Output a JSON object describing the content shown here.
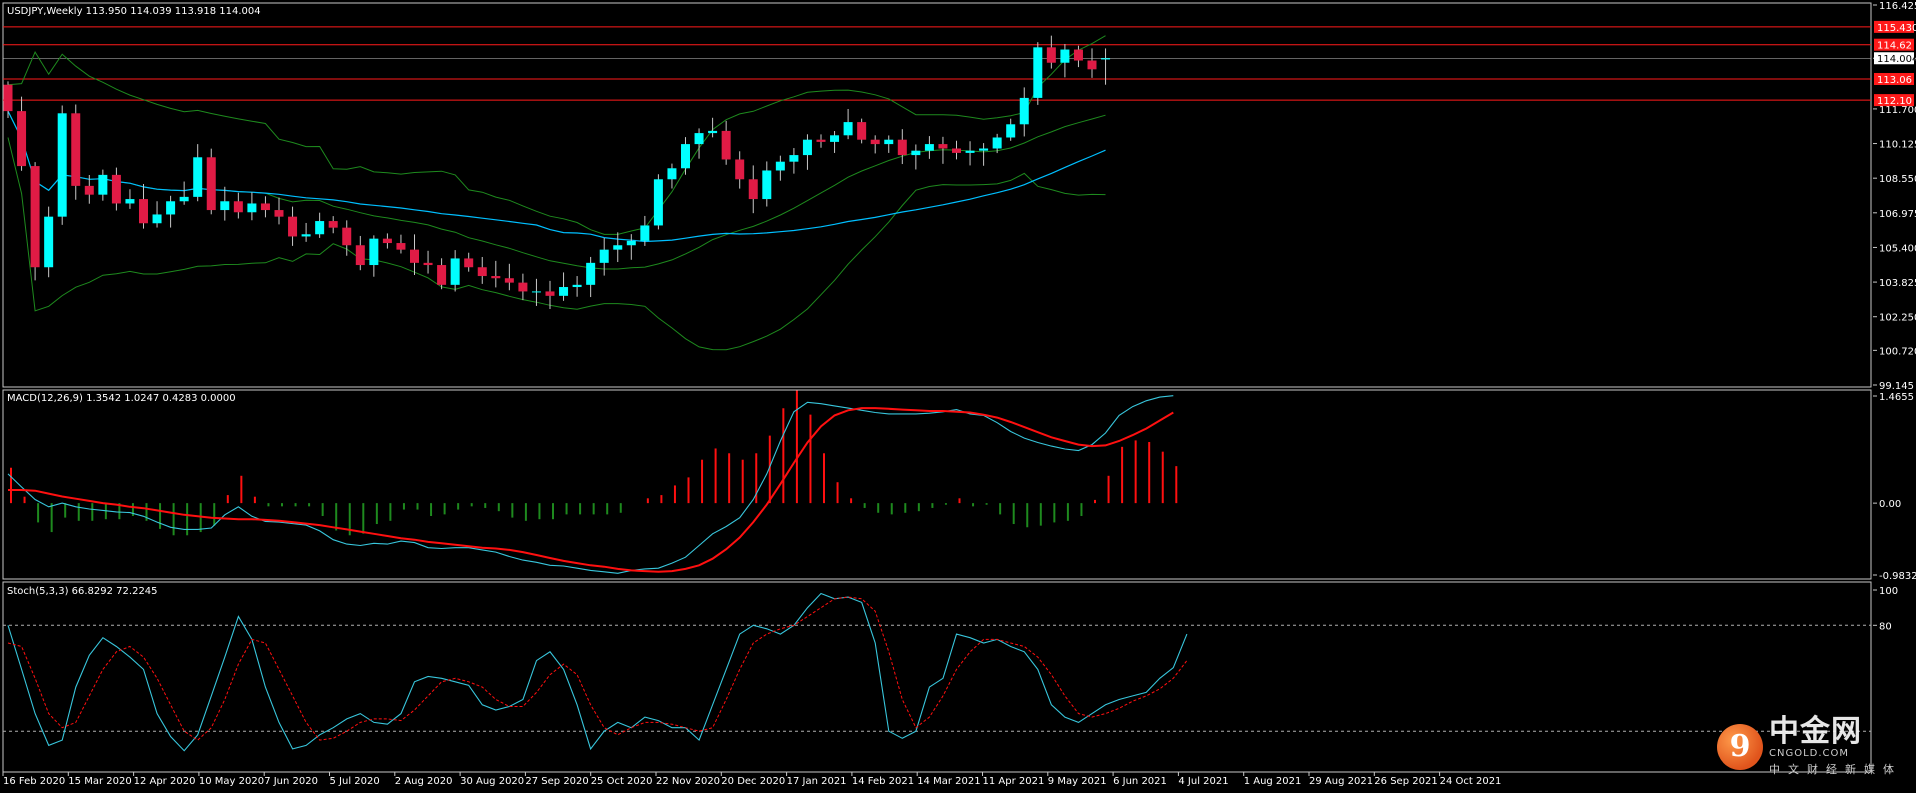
{
  "symbol_header": "USDJPY,Weekly  113.950 114.039 113.918 114.004",
  "macd_header": "MACD(12,26,9) 1.3542 1.0247 0.4283 0.0000",
  "stoch_header": "Stoch(5,3,3) 66.8292 72.2245",
  "colors": {
    "background": "#000000",
    "bull_candle": "#00ffff",
    "bear_candle": "#e01b45",
    "bollinger": "#1e8a1e",
    "ma": "#00bfff",
    "macd_line": "#38c6dc",
    "signal_line": "#ff1010",
    "hist_pos": "#ff1010",
    "hist_neg": "#1e8a1e",
    "hline": "#ff1a1a"
  },
  "logo": {
    "mark": "9",
    "name": "中金网",
    "site": "CNGOLD.COM",
    "tagline": "中文财经新媒体"
  },
  "chart_data": [
    {
      "type": "candlestick",
      "title": "USDJPY,Weekly",
      "ohlc_current": {
        "open": 113.95,
        "high": 114.039,
        "low": 113.918,
        "close": 114.004
      },
      "ylim": [
        99.145,
        116.425
      ],
      "y_ticks": [
        "116.425",
        "114.004",
        "111.700",
        "110.125",
        "108.550",
        "106.975",
        "105.400",
        "103.825",
        "102.250",
        "100.720",
        "99.145"
      ],
      "x_ticks": [
        "16 Feb 2020",
        "15 Mar 2020",
        "12 Apr 2020",
        "10 May 2020",
        "7 Jun 2020",
        "5 Jul 2020",
        "2 Aug 2020",
        "30 Aug 2020",
        "27 Sep 2020",
        "25 Oct 2020",
        "22 Nov 2020",
        "20 Dec 2020",
        "17 Jan 2021",
        "14 Feb 2021",
        "14 Mar 2021",
        "11 Apr 2021",
        "9 May 2021",
        "6 Jun 2021",
        "4 Jul 2021",
        "1 Aug 2021",
        "29 Aug 2021",
        "26 Sep 2021",
        "24 Oct 2021"
      ],
      "horizontal_levels": [
        {
          "value": 115.43,
          "label": "115.430"
        },
        {
          "value": 114.62,
          "label": "114.62"
        },
        {
          "value": 113.06,
          "label": "113.06"
        },
        {
          "value": 112.1,
          "label": "112.10"
        }
      ],
      "price_badge": {
        "value": 114.004,
        "label": "114.004"
      },
      "closes": [
        111.6,
        109.1,
        104.5,
        106.8,
        111.5,
        108.2,
        107.8,
        108.7,
        107.4,
        107.6,
        106.5,
        106.9,
        107.5,
        107.7,
        109.5,
        107.1,
        107.5,
        107.0,
        107.4,
        107.1,
        106.8,
        105.9,
        106.0,
        106.6,
        106.3,
        105.5,
        104.6,
        105.8,
        105.6,
        105.3,
        104.7,
        104.6,
        103.7,
        104.9,
        104.5,
        104.1,
        104.0,
        103.8,
        103.4,
        103.4,
        103.2,
        103.6,
        103.7,
        104.7,
        105.3,
        105.5,
        105.7,
        106.4,
        108.5,
        109.0,
        110.1,
        110.6,
        110.7,
        109.4,
        108.5,
        107.6,
        108.9,
        109.3,
        109.6,
        110.3,
        110.2,
        110.5,
        111.1,
        110.3,
        110.1,
        110.3,
        109.6,
        109.8,
        110.1,
        109.9,
        109.7,
        109.8,
        109.9,
        110.4,
        111.0,
        112.2,
        114.5,
        113.8,
        114.4,
        113.9,
        113.5,
        114.0
      ],
      "macd": [
        0.4,
        0.22,
        0.05,
        -0.05,
        0.0,
        -0.05,
        -0.08,
        -0.1,
        -0.12,
        -0.13,
        -0.18,
        -0.26,
        -0.33,
        -0.36,
        -0.36,
        -0.34,
        -0.16,
        -0.05,
        -0.18,
        -0.25,
        -0.26,
        -0.28,
        -0.3,
        -0.38,
        -0.5,
        -0.56,
        -0.58,
        -0.55,
        -0.56,
        -0.52,
        -0.54,
        -0.61,
        -0.62,
        -0.61,
        -0.61,
        -0.64,
        -0.67,
        -0.73,
        -0.78,
        -0.81,
        -0.85,
        -0.86,
        -0.89,
        -0.92,
        -0.94,
        -0.96,
        -0.92,
        -0.9,
        -0.89,
        -0.82,
        -0.74,
        -0.58,
        -0.42,
        -0.32,
        -0.2,
        0.05,
        0.4,
        0.85,
        1.25,
        1.38,
        1.36,
        1.33,
        1.3,
        1.27,
        1.24,
        1.22,
        1.22,
        1.22,
        1.23,
        1.25,
        1.28,
        1.22,
        1.2,
        1.1,
        0.98,
        0.89,
        0.83,
        0.78,
        0.74,
        0.72,
        0.8,
        0.96,
        1.2,
        1.32,
        1.4,
        1.45,
        1.47
      ],
      "signal": [
        0.18,
        0.18,
        0.17,
        0.13,
        0.09,
        0.06,
        0.03,
        0.0,
        -0.02,
        -0.05,
        -0.07,
        -0.1,
        -0.13,
        -0.16,
        -0.18,
        -0.2,
        -0.21,
        -0.22,
        -0.22,
        -0.23,
        -0.24,
        -0.26,
        -0.28,
        -0.3,
        -0.33,
        -0.36,
        -0.39,
        -0.42,
        -0.45,
        -0.48,
        -0.5,
        -0.53,
        -0.55,
        -0.57,
        -0.59,
        -0.61,
        -0.62,
        -0.64,
        -0.67,
        -0.71,
        -0.75,
        -0.79,
        -0.82,
        -0.85,
        -0.87,
        -0.9,
        -0.92,
        -0.93,
        -0.94,
        -0.93,
        -0.9,
        -0.85,
        -0.76,
        -0.63,
        -0.47,
        -0.26,
        -0.02,
        0.26,
        0.55,
        0.83,
        1.05,
        1.2,
        1.27,
        1.3,
        1.3,
        1.29,
        1.28,
        1.27,
        1.26,
        1.26,
        1.25,
        1.24,
        1.21,
        1.17,
        1.11,
        1.04,
        0.97,
        0.9,
        0.85,
        0.8,
        0.78,
        0.79,
        0.85,
        0.93,
        1.02,
        1.13,
        1.24
      ],
      "stoch_k": [
        80,
        55,
        30,
        12,
        15,
        45,
        63,
        73,
        68,
        62,
        55,
        30,
        17,
        9,
        18,
        40,
        62,
        85,
        72,
        45,
        25,
        10,
        12,
        18,
        22,
        27,
        30,
        25,
        24,
        30,
        48,
        51,
        50,
        48,
        46,
        35,
        32,
        34,
        38,
        60,
        65,
        55,
        35,
        10,
        20,
        25,
        22,
        28,
        26,
        22,
        22,
        15,
        35,
        55,
        75,
        80,
        78,
        75,
        80,
        90,
        98,
        95,
        96,
        93,
        70,
        20,
        16,
        20,
        45,
        50,
        75,
        73,
        70,
        72,
        68,
        65,
        55,
        35,
        28,
        25,
        30,
        35,
        38,
        40,
        42,
        50,
        56,
        75,
        85,
        90,
        92,
        85,
        78,
        72
      ],
      "stoch_d": [
        70,
        68,
        50,
        30,
        22,
        25,
        40,
        55,
        65,
        68,
        62,
        50,
        35,
        20,
        15,
        22,
        38,
        58,
        72,
        70,
        55,
        40,
        25,
        15,
        16,
        20,
        25,
        27,
        27,
        26,
        32,
        40,
        48,
        50,
        48,
        45,
        38,
        34,
        34,
        42,
        52,
        58,
        52,
        35,
        22,
        18,
        22,
        25,
        25,
        24,
        22,
        20,
        22,
        38,
        55,
        70,
        75,
        78,
        80,
        85,
        90,
        95,
        96,
        95,
        88,
        65,
        38,
        22,
        28,
        40,
        55,
        65,
        72,
        72,
        70,
        68,
        62,
        52,
        40,
        30,
        28,
        30,
        33,
        37,
        40,
        44,
        50,
        60,
        72,
        82,
        88,
        90,
        85,
        78
      ]
    }
  ]
}
